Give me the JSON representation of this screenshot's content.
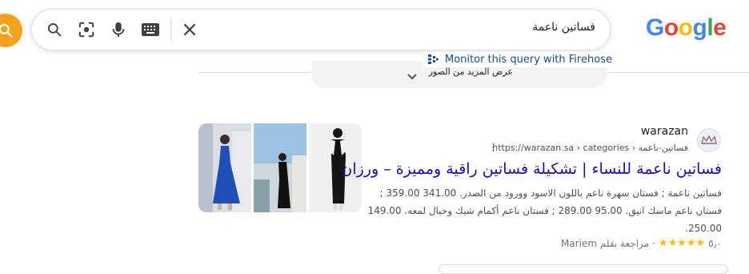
{
  "search": {
    "query": "فساتين ناعمة"
  },
  "logo": {
    "letters": [
      "G",
      "o",
      "o",
      "g",
      "l",
      "e"
    ],
    "colors": [
      "#4285f4",
      "#ea4335",
      "#fbbc05",
      "#4285f4",
      "#34a853",
      "#ea4335"
    ]
  },
  "firehose": {
    "label": "Monitor this query with Firehose"
  },
  "more_images": {
    "label": "عرض المزيد من الصور"
  },
  "result": {
    "site_name": "warazan",
    "url": "https://warazan.sa › categories › فساتين-ناعمة",
    "title": "فساتين ناعمة للنساء | تشكيلة فساتين راقية ومميزة – ورزان",
    "snippet_lines": [
      "فساتين ناعمة ; فستان سهرة ناعم باللون الاسود وورود من الصدر. 341.00  359.00 ;",
      "فستان ناعم ماسك انيق. 95.00  289.00 ; فستان ناعم أكمام شبك وحبال لمعه. 149.00",
      "250.00."
    ],
    "rating_value": "٥٫٠",
    "stars": "★★★★★",
    "review_by": "مراجعة بقلم Mariem"
  },
  "colors": {
    "accent_orange": "#f4a11c",
    "link": "#1a0dab",
    "firehose": "#1a4c8b"
  }
}
